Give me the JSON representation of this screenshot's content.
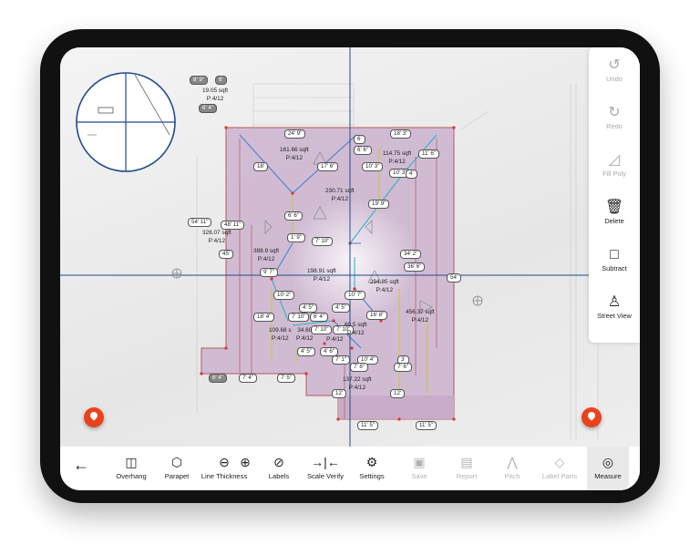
{
  "side_panel": [
    {
      "key": "undo",
      "label": "Undo",
      "icon": "undo-icon",
      "enabled": false
    },
    {
      "key": "redo",
      "label": "Redo",
      "icon": "redo-icon",
      "enabled": false
    },
    {
      "key": "fill_poly",
      "label": "Fill Poly",
      "icon": "fill-poly-icon",
      "enabled": false
    },
    {
      "key": "delete",
      "label": "Delete",
      "icon": "trash-icon",
      "enabled": true
    },
    {
      "key": "subtract",
      "label": "Subtract",
      "icon": "square-icon",
      "enabled": true
    },
    {
      "key": "street_view",
      "label": "Street View",
      "icon": "person-icon",
      "enabled": true
    }
  ],
  "toolbar": [
    {
      "key": "overhang",
      "label": "Overhang",
      "icon": "overhang-icon",
      "enabled": true
    },
    {
      "key": "parapet",
      "label": "Parapet",
      "icon": "parapet-icon",
      "enabled": true
    },
    {
      "key": "line_thickness_minus",
      "label": "Line Thickness",
      "icon": "minus-circle-icon",
      "enabled": true
    },
    {
      "key": "line_thickness_plus",
      "label": "",
      "icon": "plus-circle-icon",
      "enabled": true
    },
    {
      "key": "labels",
      "label": "Labels",
      "icon": "eye-off-icon",
      "enabled": true
    },
    {
      "key": "scale_verify",
      "label": "Scale Verify",
      "icon": "scale-verify-icon",
      "enabled": true
    },
    {
      "key": "settings",
      "label": "Settings",
      "icon": "gear-icon",
      "enabled": true
    },
    {
      "key": "save",
      "label": "Save",
      "icon": "save-icon",
      "enabled": false
    },
    {
      "key": "report",
      "label": "Report",
      "icon": "report-icon",
      "enabled": false
    },
    {
      "key": "pitch",
      "label": "Pitch",
      "icon": "pitch-icon",
      "enabled": false
    },
    {
      "key": "label_parts",
      "label": "Label Parts",
      "icon": "tag-icon",
      "enabled": false
    },
    {
      "key": "measure",
      "label": "Measure",
      "icon": "tape-measure-icon",
      "enabled": true,
      "active": true
    }
  ],
  "back_icon": "back-arrow-icon",
  "pins": [
    "location-pin-icon",
    "location-pin-icon"
  ],
  "dimension_labels": [
    "8' 9\"",
    "6'",
    "6' 4\"",
    "24' 9\"",
    "18' 3\"",
    "6'",
    "6' 6\"",
    "11' 6\"",
    "10' 3\"",
    "10' 3\"",
    "4'",
    "18'",
    "17' 6\"",
    "19' 9\"",
    "6' 6\"",
    "54' 11\"",
    "48' 11\"",
    "45'",
    "1' 9\"",
    "7' 10\"",
    "34' 2\"",
    "36' 6\"",
    "9' 7\"",
    "54'",
    "10' 2\"",
    "10' 7\"",
    "4' 5\"",
    "4' 5\"",
    "18' 4\"",
    "7' 10\"",
    "6' 4\"",
    "16' 8\"",
    "7' 10\"",
    "7' 10\"",
    "4' 5\"",
    "4' 6\"",
    "7' 1\"",
    "10' 4\"",
    "7' 8\"",
    "3'",
    "7' 6\"",
    "6' 4\"",
    "7' 4\"",
    "7' 5\"",
    "12'",
    "12'",
    "11' 5\"",
    "11' 5\""
  ],
  "areas": [
    {
      "sqft": "19.05 sqft",
      "pitch": "P:4/12"
    },
    {
      "sqft": "161.66 sqft",
      "pitch": "P:4/12"
    },
    {
      "sqft": "114.75 sqft",
      "pitch": "P:4/12"
    },
    {
      "sqft": "230.71 sqft",
      "pitch": "P:4/12"
    },
    {
      "sqft": "328.07 sqft",
      "pitch": "P:4/12"
    },
    {
      "sqft": "388.9 sqft",
      "pitch": "P:4/12"
    },
    {
      "sqft": "198.91 sqft",
      "pitch": "P:4/12"
    },
    {
      "sqft": "294.85 sqft",
      "pitch": "P:4/12"
    },
    {
      "sqft": "456.37 sqft",
      "pitch": "P:4/12"
    },
    {
      "sqft": "109.68 s",
      "pitch": "P:4/12"
    },
    {
      "sqft": "34.60",
      "pitch": "P:4/12"
    },
    {
      "sqft": "P:4/12",
      "pitch": ""
    },
    {
      "sqft": "60.5 sqft",
      "pitch": "P:4/12"
    },
    {
      "sqft": "137.22 sqft",
      "pitch": "P:4/12"
    }
  ],
  "colors": {
    "roof_fill": "#cbb3cf",
    "roof_outline": "#b45a5a",
    "crosshair": "#1e4b8f",
    "ridge": "#2bb5c8",
    "hip": "#3d7fd6",
    "valley": "#c8c83a",
    "pin": "#e8431b"
  }
}
